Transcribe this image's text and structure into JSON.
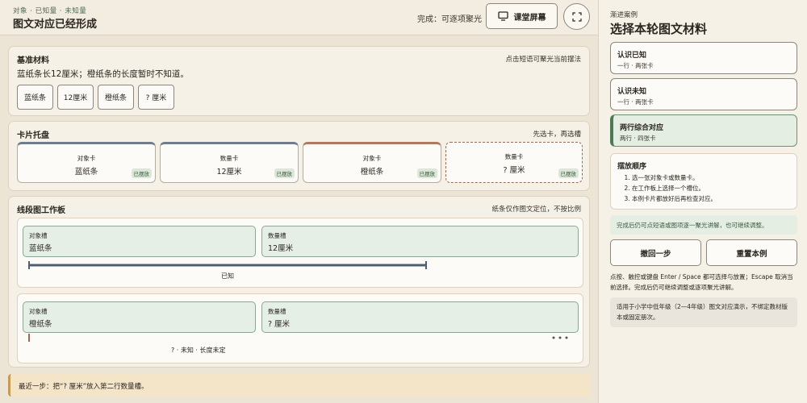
{
  "header": {
    "breadcrumb": "对象 · 已知量 · 未知量",
    "title": "图文对应已经形成",
    "status": "完成：可逐项聚光",
    "screen_button": "课堂屏幕"
  },
  "reference": {
    "title": "基准材料",
    "hint": "点击短语可聚光当前摆法",
    "text": "蓝纸条长12厘米；橙纸条的长度暂时不知道。",
    "chips": [
      "蓝纸条",
      "12厘米",
      "橙纸条",
      "? 厘米"
    ]
  },
  "tray": {
    "title": "卡片托盘",
    "hint": "先选卡，再选槽",
    "cards": [
      {
        "type": "对象卡",
        "value": "蓝纸条",
        "badge": "已摆放"
      },
      {
        "type": "数量卡",
        "value": "12厘米",
        "badge": "已摆放"
      },
      {
        "type": "对象卡",
        "value": "橙纸条",
        "badge": "已摆放"
      },
      {
        "type": "数量卡",
        "value": "? 厘米",
        "badge": "已摆放"
      }
    ]
  },
  "board": {
    "title": "线段图工作板",
    "hint": "纸条仅作图文定位，不按比例",
    "rows": [
      {
        "obj_label": "对象槽",
        "obj_value": "蓝纸条",
        "qty_label": "数量槽",
        "qty_value": "12厘米",
        "bar_label": "已知",
        "bar_color": "#4f5f70"
      },
      {
        "obj_label": "对象槽",
        "obj_value": "橙纸条",
        "qty_label": "数量槽",
        "qty_value": "? 厘米",
        "bar_label": "? · 未知 · 长度未定",
        "bar_color": "#9a6a55"
      }
    ]
  },
  "footer": {
    "last_step": "最近一步：把“? 厘米”放入第二行数量槽。"
  },
  "side": {
    "breadcrumb": "渐进案例",
    "title": "选择本轮图文材料",
    "cases": [
      {
        "title": "认识已知",
        "sub": "一行 · 两张卡"
      },
      {
        "title": "认识未知",
        "sub": "一行 · 两张卡"
      },
      {
        "title": "两行综合对应",
        "sub": "两行 · 四张卡"
      }
    ],
    "order_title": "摆放顺序",
    "order_steps": [
      "选一张对象卡或数量卡。",
      "在工作板上选择一个槽位。",
      "本例卡片都放好后再检查对应。"
    ],
    "done_note": "完成后仍可点短语或图项逐一聚光讲解，也可继续调整。",
    "undo": "撤回一步",
    "reset": "重置本例",
    "help": "点按、触控或键盘 Enter / Space 都可选择与放置；Escape 取消当前选择。完成后仍可继续调整或逐项聚光讲解。",
    "scope": "适用于小学中低年级（2—4年级）图文对应演示，不绑定教材版本或固定册次。"
  },
  "colors": {
    "accent_green": "#4f7a55",
    "blue_bar": "#4f5f70",
    "orange_bar": "#9a6a55"
  }
}
